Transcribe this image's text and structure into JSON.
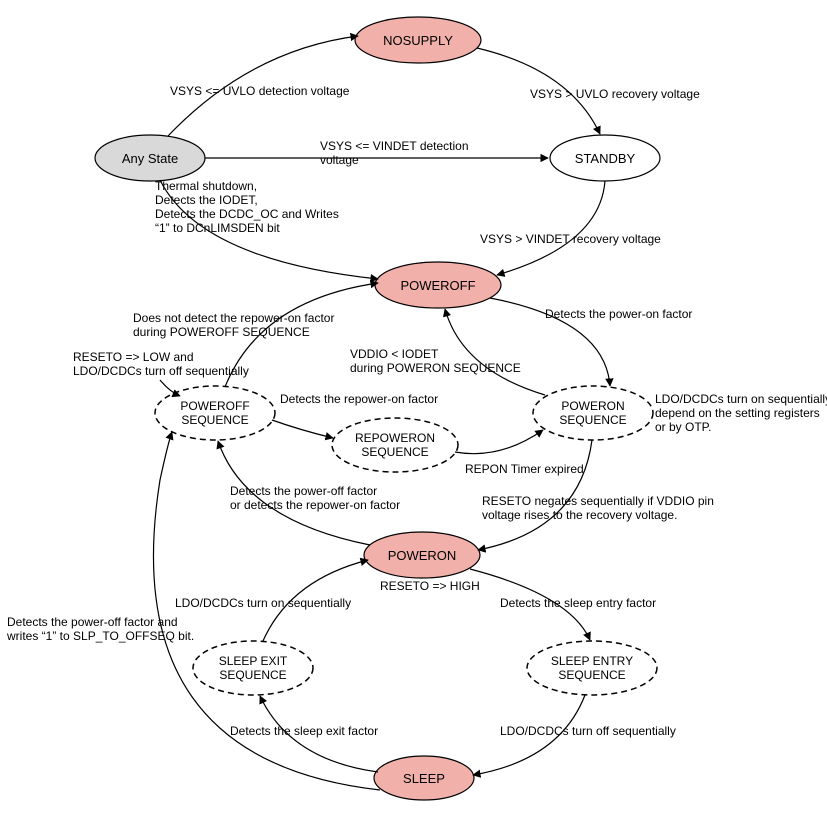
{
  "chart_data": {
    "type": "state_diagram",
    "title": "",
    "states": [
      {
        "id": "anystate",
        "label": "Any State",
        "kind": "neutral"
      },
      {
        "id": "nosupply",
        "label": "NOSUPPLY",
        "kind": "solid"
      },
      {
        "id": "standby",
        "label": "STANDBY",
        "kind": "plain"
      },
      {
        "id": "poweroff",
        "label": "POWEROFF",
        "kind": "solid"
      },
      {
        "id": "poweroff_seq",
        "label": "POWEROFF SEQUENCE",
        "kind": "transient"
      },
      {
        "id": "repoweron_seq",
        "label": "REPOWERON SEQUENCE",
        "kind": "transient"
      },
      {
        "id": "poweron_seq",
        "label": "POWERON SEQUENCE",
        "kind": "transient"
      },
      {
        "id": "poweron",
        "label": "POWERON",
        "kind": "solid"
      },
      {
        "id": "sleep_exit_seq",
        "label": "SLEEP EXIT SEQUENCE",
        "kind": "transient"
      },
      {
        "id": "sleep_entry_seq",
        "label": "SLEEP ENTRY SEQUENCE",
        "kind": "transient"
      },
      {
        "id": "sleep",
        "label": "SLEEP",
        "kind": "solid"
      }
    ],
    "transitions": [
      {
        "from": "anystate",
        "to": "nosupply",
        "label": "VSYS <= UVLO detection voltage"
      },
      {
        "from": "nosupply",
        "to": "standby",
        "label": "VSYS > UVLO recovery voltage"
      },
      {
        "from": "anystate",
        "to": "standby",
        "label": "VSYS <= VINDET detection voltage"
      },
      {
        "from": "standby",
        "to": "poweroff",
        "label": "VSYS > VINDET recovery voltage"
      },
      {
        "from": "anystate",
        "to": "poweroff",
        "label": "Thermal shutdown, Detects the IODET, Detects the DCDC_OC and Writes \"1\" to DCnLIMSDEN bit"
      },
      {
        "from": "poweroff",
        "to": "poweron_seq",
        "label": "Detects the power-on factor"
      },
      {
        "from": "poweron_seq",
        "to": "poweroff",
        "label": "VDDIO < IODET during POWERON SEQUENCE"
      },
      {
        "from": "poweron_seq",
        "to": "poweron",
        "label": "RESETO negates sequentially if VDDIO pin voltage rises to the recovery voltage."
      },
      {
        "from": "poweron",
        "to": "poweroff_seq",
        "label": "Detects the power-off factor or detects the repower-on factor"
      },
      {
        "from": "poweroff_seq",
        "to": "poweroff",
        "label": "Does not detect the repower-on factor during POWEROFF SEQUENCE"
      },
      {
        "from": "poweroff_seq",
        "to": "repoweron_seq",
        "label": "Detects the repower-on factor"
      },
      {
        "from": "repoweron_seq",
        "to": "poweron_seq",
        "label": "REPON Timer expired"
      },
      {
        "from": "poweron",
        "to": "sleep_entry_seq",
        "label": "Detects the sleep entry factor"
      },
      {
        "from": "sleep_entry_seq",
        "to": "sleep",
        "label": "LDO/DCDCs turn off sequentially"
      },
      {
        "from": "sleep",
        "to": "sleep_exit_seq",
        "label": "Detects the sleep exit factor"
      },
      {
        "from": "sleep_exit_seq",
        "to": "poweron",
        "label": "LDO/DCDCs turn on sequentially"
      },
      {
        "from": "sleep",
        "to": "poweroff_seq",
        "label": "Detects the power-off factor and writes \"1\" to SLP_TO_OFFSEQ bit."
      }
    ],
    "annotations": [
      {
        "at": "poweroff_seq",
        "text": "RESETO => LOW and LDO/DCDCs turn off sequentially"
      },
      {
        "at": "poweron_seq",
        "text": "LDO/DCDCs turn on sequentially depend on the setting registers or by OTP."
      },
      {
        "at": "poweron",
        "text": "RESETO => HIGH"
      }
    ]
  },
  "nodes": {
    "anystate": "Any State",
    "nosupply": "NOSUPPLY",
    "standby": "STANDBY",
    "poweroff": "POWEROFF",
    "poweroff_seq_l1": "POWEROFF",
    "poweroff_seq_l2": "SEQUENCE",
    "repoweron_seq_l1": "REPOWERON",
    "repoweron_seq_l2": "SEQUENCE",
    "poweron_seq_l1": "POWERON",
    "poweron_seq_l2": "SEQUENCE",
    "poweron": "POWERON",
    "sleep_exit_seq_l1": "SLEEP EXIT",
    "sleep_exit_seq_l2": "SEQUENCE",
    "sleep_entry_seq_l1": "SLEEP ENTRY",
    "sleep_entry_seq_l2": "SEQUENCE",
    "sleep": "SLEEP"
  },
  "labels": {
    "t_any_nosupply": "VSYS <= UVLO detection voltage",
    "t_nosupply_standby": "VSYS > UVLO recovery voltage",
    "t_any_standby_l1": "VSYS <= VINDET detection",
    "t_any_standby_l2": "voltage",
    "t_standby_poweroff": "VSYS > VINDET recovery voltage",
    "t_any_poweroff_l1": "Thermal shutdown,",
    "t_any_poweroff_l2": "Detects the IODET,",
    "t_any_poweroff_l3": "Detects the DCDC_OC and Writes",
    "t_any_poweroff_l4": "“1” to   DCnLIMSDEN bit",
    "t_poff_pwonseq": "Detects the power-on factor",
    "t_pwonseq_poff_l1": "VDDIO < IODET",
    "t_pwonseq_poff_l2": "during POWERON SEQUENCE",
    "t_pwonseq_pwon_l1": "RESETO negates sequentially if VDDIO pin",
    "t_pwonseq_pwon_l2": "voltage rises to the recovery voltage.",
    "t_pwon_poffseq_l1": "Detects the power-off factor",
    "t_pwon_poffseq_l2": "or detects the repower-on factor",
    "t_poffseq_poff_l1": "Does not detect the repower-on factor",
    "t_poffseq_poff_l2": "during POWEROFF SEQUENCE",
    "t_poffseq_repon": "Detects the repower-on factor",
    "t_repon_pwonseq": "REPON Timer expired",
    "t_pwon_sleepentry": "Detects the sleep entry factor",
    "t_sleepentry_sleep": "LDO/DCDCs turn off sequentially",
    "t_sleep_sleepexit": "Detects the sleep exit factor",
    "t_sleepexit_pwon": "LDO/DCDCs turn on sequentially",
    "t_sleep_poffseq_l1": "Detects the power-off factor and",
    "t_sleep_poffseq_l2": "writes “1” to SLP_TO_OFFSEQ bit.",
    "ann_poffseq_l1": "RESETO => LOW and",
    "ann_poffseq_l2": "LDO/DCDCs turn off  sequentially",
    "ann_pwonseq_l1": "LDO/DCDCs turn on sequentially",
    "ann_pwonseq_l2": "depend on the setting registers",
    "ann_pwonseq_l3": "or by OTP.",
    "ann_pwon": "RESETO => HIGH"
  }
}
